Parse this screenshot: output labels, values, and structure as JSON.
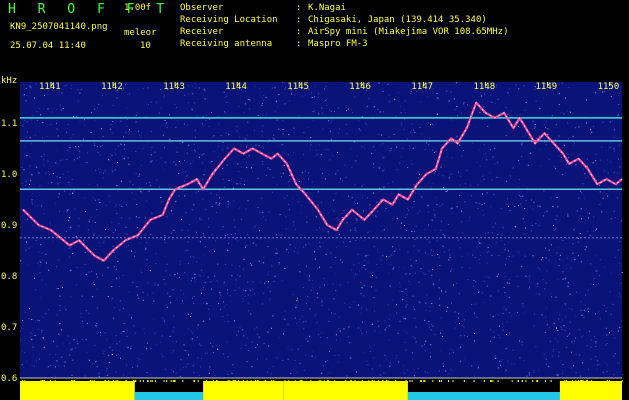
{
  "header": {
    "brand": "H R O F F T",
    "version": "1.00f",
    "filename": "KN9_2507041140.png",
    "datetime": "25.07.04 11:40",
    "mode_label": "meleor",
    "mode_value": "10",
    "meta": [
      {
        "label": "Observer",
        "value": "K.Nagai"
      },
      {
        "label": "Receiving Location",
        "value": "Chigasaki, Japan (139.414 35.340)"
      },
      {
        "label": "Receiver",
        "value": "AirSpy mini (Miakejima VOR 108.65MHz)"
      },
      {
        "label": "Receiving antenna",
        "value": "Maspro FM-3"
      }
    ]
  },
  "chart_data": {
    "type": "heatmap",
    "ylabel": "kHz",
    "x_ticks": [
      "1141",
      "1142",
      "1143",
      "1144",
      "1145",
      "1146",
      "1147",
      "1148",
      "1149",
      "1150"
    ],
    "y_ticks": [
      "1.1",
      "1.0",
      "0.9",
      "0.8",
      "0.7",
      "0.6"
    ],
    "ylim": [
      0.6,
      1.15
    ],
    "xlim": [
      1140.5,
      1150.2
    ],
    "horizontal_lines_khz": [
      1.11,
      1.065,
      0.97,
      0.875
    ],
    "doppler_trace": [
      [
        1140.55,
        0.93
      ],
      [
        1140.8,
        0.9
      ],
      [
        1141.0,
        0.89
      ],
      [
        1141.3,
        0.86
      ],
      [
        1141.45,
        0.87
      ],
      [
        1141.7,
        0.84
      ],
      [
        1141.85,
        0.83
      ],
      [
        1142.0,
        0.85
      ],
      [
        1142.2,
        0.87
      ],
      [
        1142.4,
        0.88
      ],
      [
        1142.6,
        0.91
      ],
      [
        1142.8,
        0.92
      ],
      [
        1142.9,
        0.95
      ],
      [
        1143.0,
        0.97
      ],
      [
        1143.2,
        0.98
      ],
      [
        1143.35,
        0.99
      ],
      [
        1143.45,
        0.97
      ],
      [
        1143.6,
        1.0
      ],
      [
        1143.8,
        1.03
      ],
      [
        1143.95,
        1.05
      ],
      [
        1144.1,
        1.04
      ],
      [
        1144.25,
        1.05
      ],
      [
        1144.4,
        1.04
      ],
      [
        1144.55,
        1.03
      ],
      [
        1144.65,
        1.04
      ],
      [
        1144.8,
        1.02
      ],
      [
        1144.95,
        0.98
      ],
      [
        1145.1,
        0.96
      ],
      [
        1145.3,
        0.93
      ],
      [
        1145.45,
        0.9
      ],
      [
        1145.6,
        0.89
      ],
      [
        1145.7,
        0.91
      ],
      [
        1145.85,
        0.93
      ],
      [
        1145.95,
        0.92
      ],
      [
        1146.05,
        0.91
      ],
      [
        1146.2,
        0.93
      ],
      [
        1146.35,
        0.95
      ],
      [
        1146.5,
        0.94
      ],
      [
        1146.6,
        0.96
      ],
      [
        1146.75,
        0.95
      ],
      [
        1146.9,
        0.98
      ],
      [
        1147.05,
        1.0
      ],
      [
        1147.2,
        1.01
      ],
      [
        1147.3,
        1.05
      ],
      [
        1147.45,
        1.07
      ],
      [
        1147.55,
        1.06
      ],
      [
        1147.7,
        1.09
      ],
      [
        1147.85,
        1.14
      ],
      [
        1148.0,
        1.12
      ],
      [
        1148.15,
        1.11
      ],
      [
        1148.3,
        1.12
      ],
      [
        1148.45,
        1.09
      ],
      [
        1148.55,
        1.11
      ],
      [
        1148.7,
        1.08
      ],
      [
        1148.8,
        1.06
      ],
      [
        1148.95,
        1.08
      ],
      [
        1149.1,
        1.06
      ],
      [
        1149.25,
        1.04
      ],
      [
        1149.35,
        1.02
      ],
      [
        1149.5,
        1.03
      ],
      [
        1149.65,
        1.01
      ],
      [
        1149.8,
        0.98
      ],
      [
        1149.95,
        0.99
      ],
      [
        1150.1,
        0.98
      ],
      [
        1150.2,
        0.99
      ]
    ],
    "activity_segments": [
      {
        "start": 1140.5,
        "end": 1142.35,
        "level": "high"
      },
      {
        "start": 1142.35,
        "end": 1143.45,
        "level": "low"
      },
      {
        "start": 1143.45,
        "end": 1144.75,
        "level": "high"
      },
      {
        "start": 1144.75,
        "end": 1146.75,
        "level": "high"
      },
      {
        "start": 1146.75,
        "end": 1149.2,
        "level": "low"
      },
      {
        "start": 1149.2,
        "end": 1150.2,
        "level": "high"
      }
    ]
  }
}
